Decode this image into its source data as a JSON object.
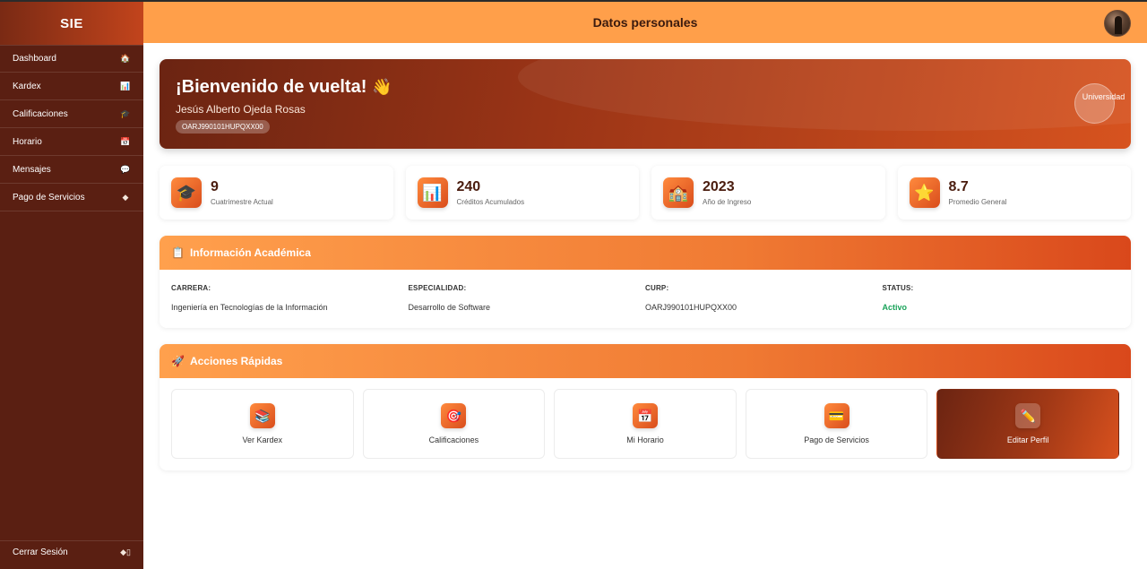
{
  "sidebar": {
    "brand": "SIE",
    "items": [
      {
        "label": "Dashboard",
        "icon": "🏠"
      },
      {
        "label": "Kardex",
        "icon": "📊"
      },
      {
        "label": "Calificaciones",
        "icon": "🎓"
      },
      {
        "label": "Horario",
        "icon": "📅"
      },
      {
        "label": "Mensajes",
        "icon": "💬"
      },
      {
        "label": "Pago de Servicios",
        "icon": "◆"
      }
    ],
    "logout": {
      "label": "Cerrar Sesión",
      "icon": "◆▯"
    }
  },
  "header": {
    "title": "Datos personales"
  },
  "welcome": {
    "title": "¡Bienvenido de vuelta!",
    "emoji": "👋",
    "name": "Jesús Alberto Ojeda Rosas",
    "curp_badge": "OARJ990101HUPQXX00",
    "logo_text": "Universidad"
  },
  "stats": [
    {
      "icon": "🎓",
      "value": "9",
      "label": "Cuatrimestre Actual"
    },
    {
      "icon": "📊",
      "value": "240",
      "label": "Créditos Acumulados"
    },
    {
      "icon": "🏫",
      "value": "2023",
      "label": "Año de Ingreso"
    },
    {
      "icon": "⭐",
      "value": "8.7",
      "label": "Promedio General"
    }
  ],
  "academic": {
    "title": "Información Académica",
    "icon": "📋",
    "fields": [
      {
        "label": "CARRERA:",
        "value": "Ingeniería en Tecnologías de la Información"
      },
      {
        "label": "ESPECIALIDAD:",
        "value": "Desarrollo de Software"
      },
      {
        "label": "CURP:",
        "value": "OARJ990101HUPQXX00"
      },
      {
        "label": "STATUS:",
        "value": "Activo"
      }
    ]
  },
  "quick_actions": {
    "title": "Acciones Rápidas",
    "icon": "🚀",
    "items": [
      {
        "icon": "📚",
        "label": "Ver Kardex"
      },
      {
        "icon": "🎯",
        "label": "Calificaciones"
      },
      {
        "icon": "📅",
        "label": "Mi Horario"
      },
      {
        "icon": "💳",
        "label": "Pago de Servicios"
      },
      {
        "icon": "✏️",
        "label": "Editar Perfil"
      }
    ]
  },
  "colors": {
    "sidebar_bg": "#5a1f12",
    "header_bg": "#ff9f4a",
    "accent": "#d94d1c",
    "status_active": "#1aa35a"
  }
}
